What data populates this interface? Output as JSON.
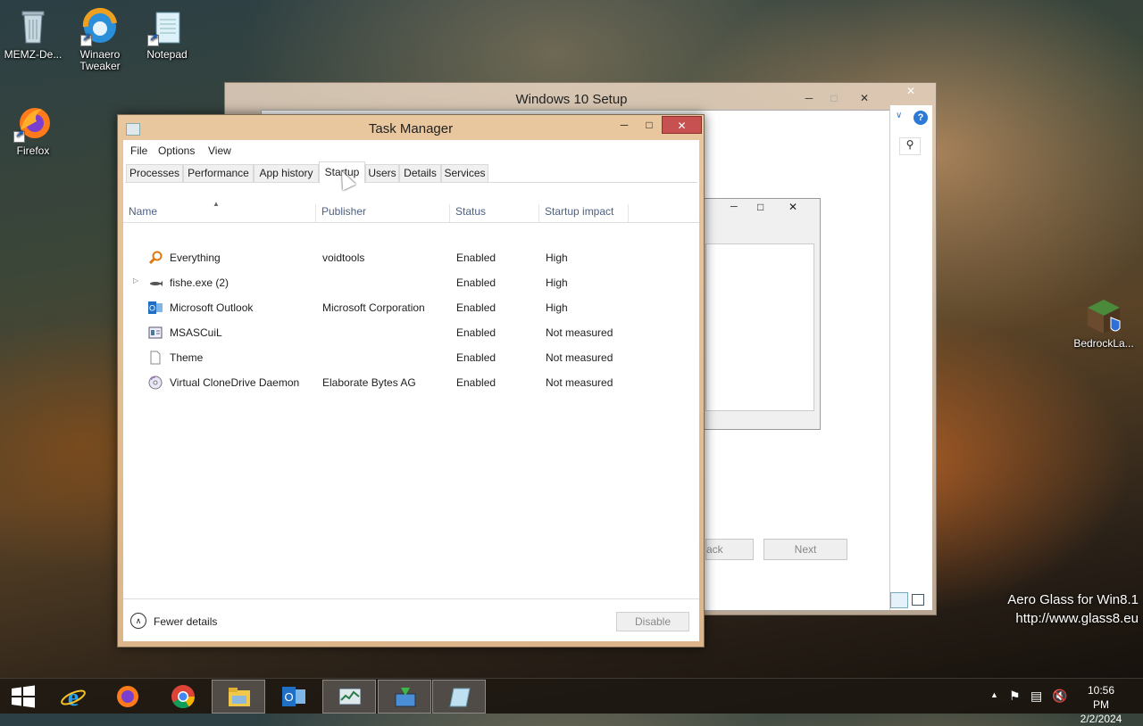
{
  "desktop": {
    "icons": [
      {
        "label": "MEMZ-De...",
        "icon": "recycle-bin-icon"
      },
      {
        "label": "Winaero Tweaker",
        "icon": "winaero-tweaker-icon"
      },
      {
        "label": "Notepad",
        "icon": "notepad-icon"
      },
      {
        "label": "Firefox",
        "icon": "firefox-icon"
      },
      {
        "label": "BedrockLa...",
        "icon": "bedrock-launcher-icon"
      }
    ],
    "watermark_line1": "Aero Glass for Win8.1",
    "watermark_line2": "http://www.glass8.eu"
  },
  "setup_window": {
    "title": "Windows 10 Setup",
    "back_label": "ack",
    "next_label": "Next"
  },
  "task_manager": {
    "title": "Task Manager",
    "menu": [
      "File",
      "Options",
      "View"
    ],
    "tabs": [
      "Processes",
      "Performance",
      "App history",
      "Startup",
      "Users",
      "Details",
      "Services"
    ],
    "active_tab": "Startup",
    "columns": [
      "Name",
      "Publisher",
      "Status",
      "Startup impact"
    ],
    "rows": [
      {
        "name": "Everything",
        "publisher": "voidtools",
        "status": "Enabled",
        "impact": "High",
        "icon": "everything-search-icon"
      },
      {
        "name": "fishe.exe (2)",
        "publisher": "",
        "status": "Enabled",
        "impact": "High",
        "icon": "fish-icon"
      },
      {
        "name": "Microsoft Outlook",
        "publisher": "Microsoft Corporation",
        "status": "Enabled",
        "impact": "High",
        "icon": "outlook-icon"
      },
      {
        "name": "MSASCuiL",
        "publisher": "",
        "status": "Enabled",
        "impact": "Not measured",
        "icon": "defender-icon"
      },
      {
        "name": "Theme",
        "publisher": "",
        "status": "Enabled",
        "impact": "Not measured",
        "icon": "blank-file-icon"
      },
      {
        "name": "Virtual CloneDrive Daemon",
        "publisher": "Elaborate Bytes AG",
        "status": "Enabled",
        "impact": "Not measured",
        "icon": "disc-icon"
      }
    ],
    "fewer_details": "Fewer details",
    "disable": "Disable"
  },
  "taskbar": {
    "apps": [
      "start-icon",
      "internet-explorer-icon",
      "firefox-icon",
      "chrome-icon",
      "file-explorer-icon",
      "outlook-icon",
      "task-manager-icon",
      "setup-icon",
      "glass-icon"
    ],
    "time": "10:56 PM",
    "date": "2/2/2024"
  },
  "colors": {
    "accent": "#c75050",
    "frame": "#e9c79f",
    "header_text": "#4d6082"
  }
}
